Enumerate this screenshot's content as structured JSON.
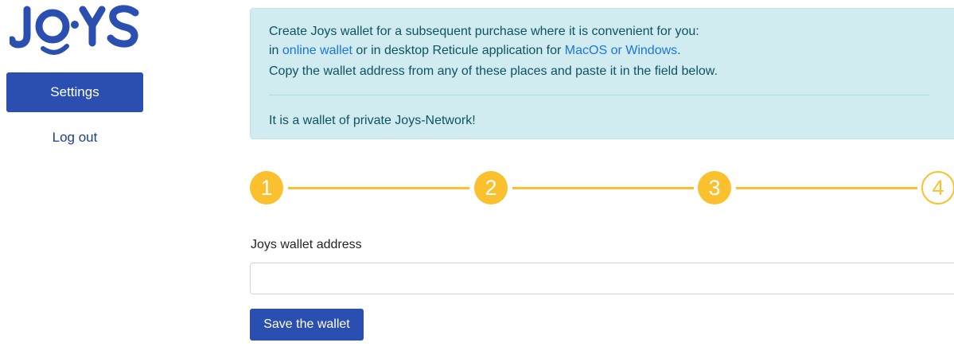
{
  "brand": {
    "logo_text": "JOYS",
    "color": "#2a4fb0"
  },
  "sidebar": {
    "settings_label": "Settings",
    "logout_label": "Log out"
  },
  "info": {
    "line1": "Create Joys wallet for a subsequent purchase where it is convenient for you:",
    "line2_prefix": "in ",
    "online_wallet_link": "online wallet",
    "line2_middle": " or in desktop Reticule application for ",
    "platforms_link": "MacOS or Windows",
    "line2_suffix": ".",
    "line3": "Copy the wallet address from any of these places and paste it in the field below.",
    "note": "It is a wallet of private Joys-Network!"
  },
  "stepper": {
    "steps": [
      "1",
      "2",
      "3",
      "4"
    ],
    "active_color": "#fbc02d"
  },
  "form": {
    "wallet_label": "Joys wallet address",
    "wallet_value": "",
    "wallet_placeholder": "",
    "save_label": "Save the wallet"
  }
}
